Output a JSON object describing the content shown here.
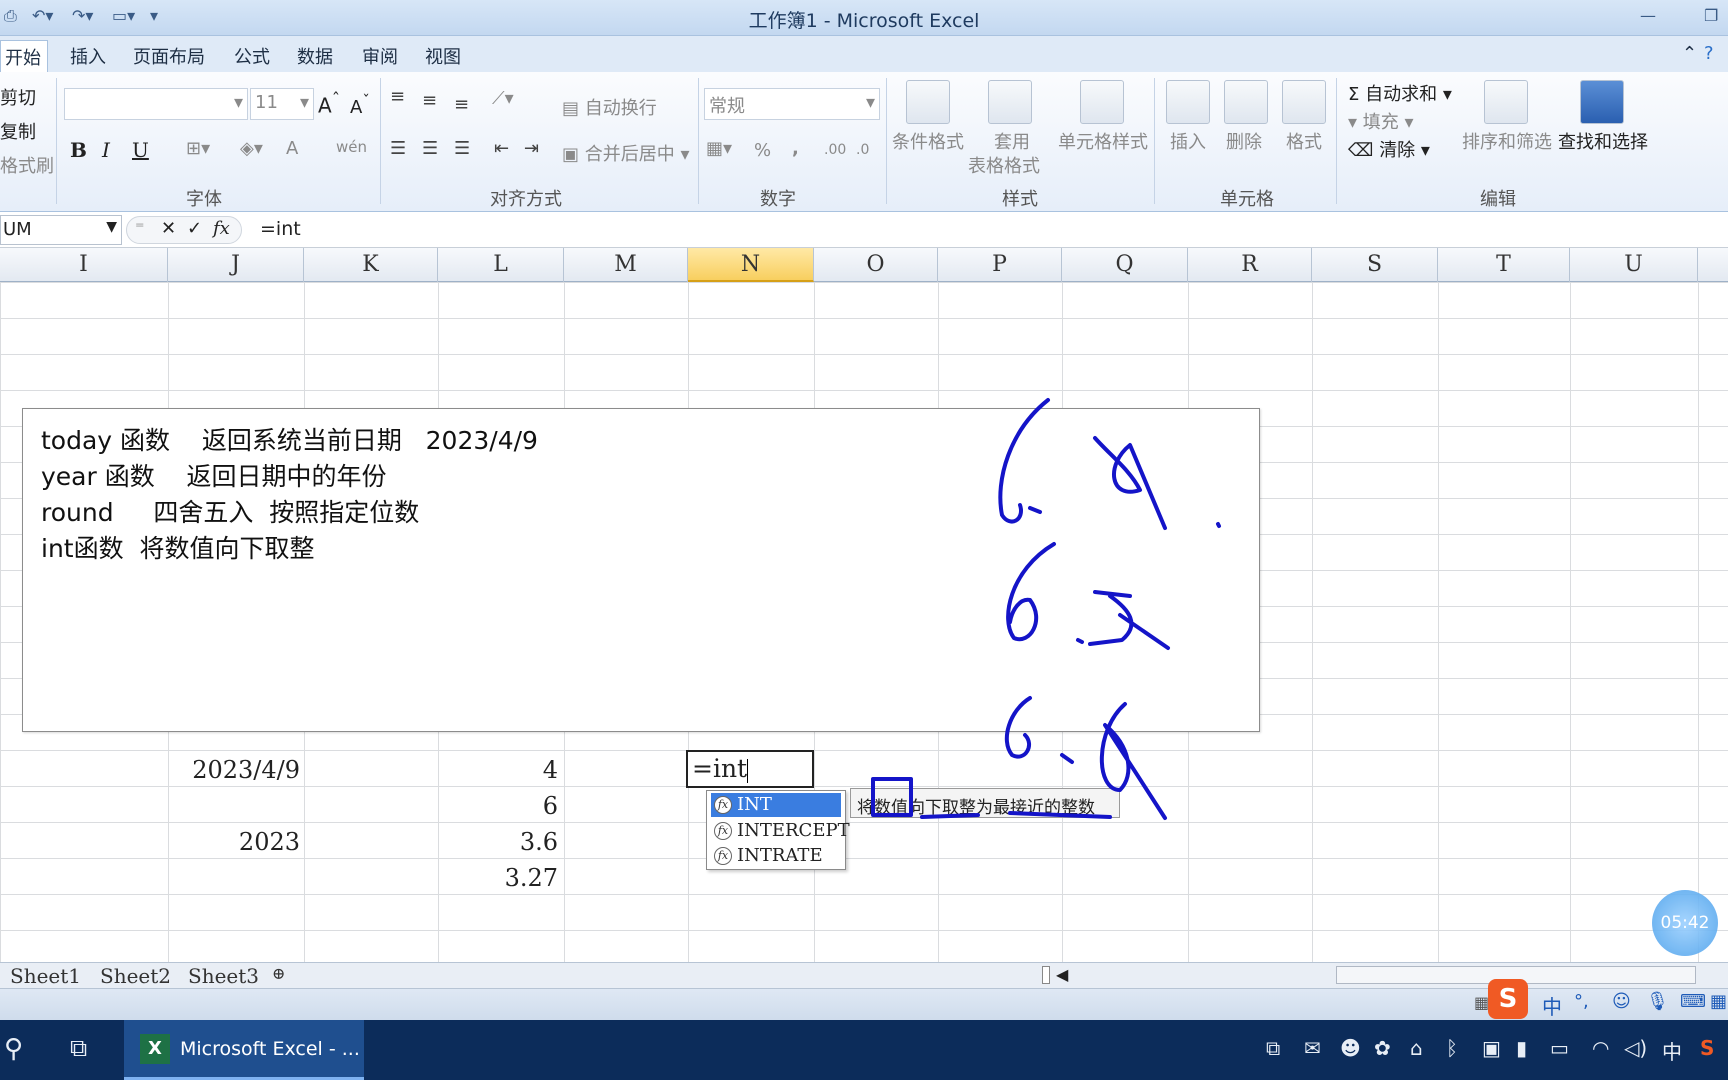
{
  "window": {
    "title": "工作簿1 - Microsoft Excel"
  },
  "tabs": [
    "开始",
    "插入",
    "页面布局",
    "公式",
    "数据",
    "审阅",
    "视图"
  ],
  "clipboard": {
    "cut": "剪切",
    "copy": "复制",
    "format_painter": "格式刷"
  },
  "font_group": {
    "label": "字体",
    "font_size": "11",
    "bold": "B",
    "italic": "I",
    "underline": "U",
    "font_color": "A",
    "phonetic": "wén"
  },
  "alignment_group": {
    "label": "对齐方式",
    "wrap_text": "自动换行",
    "merge_center": "合并后居中"
  },
  "number_group": {
    "label": "数字",
    "format": "常规",
    "percent": "%",
    "comma": ","
  },
  "styles_group": {
    "label": "样式",
    "conditional": "条件格式",
    "table_format_1": "套用",
    "table_format_2": "表格格式",
    "cell_styles": "单元格样式"
  },
  "cells_group": {
    "label": "单元格",
    "insert": "插入",
    "delete": "删除",
    "format": "格式"
  },
  "editing_group": {
    "label": "编辑",
    "autosum": "自动求和",
    "fill": "填充",
    "clear": "清除",
    "sort_filter": "排序和筛选",
    "find_select": "查找和选择"
  },
  "formula_bar": {
    "name_box": "UM",
    "fx": "fx",
    "content": "=int"
  },
  "columns": [
    "I",
    "J",
    "K",
    "L",
    "M",
    "N",
    "O",
    "P",
    "Q",
    "R",
    "S",
    "T",
    "U"
  ],
  "selected_column": "N",
  "textbox_lines": [
    "today 函数    返回系统当前日期   2023/4/9",
    "year 函数    返回日期中的年份",
    "round     四舍五入  按照指定位数",
    "int函数  将数值向下取整"
  ],
  "cells": {
    "J_date": "2023/4/9",
    "J_year": "2023",
    "L1": "4",
    "L2": "6",
    "L3": "3.6",
    "L4": "3.27"
  },
  "active_cell": {
    "content": "=int"
  },
  "autocomplete": [
    "INT",
    "INTERCEPT",
    "INTRATE"
  ],
  "tooltip": "将数值向下取整为最接近的整数",
  "sheets": [
    "Sheet1",
    "Sheet2",
    "Sheet3"
  ],
  "handwriting": [
    "6.8",
    "6.5",
    "6.8"
  ],
  "timer": "05:42",
  "taskbar": {
    "app": "Microsoft Excel - ...",
    "ime": "中"
  }
}
